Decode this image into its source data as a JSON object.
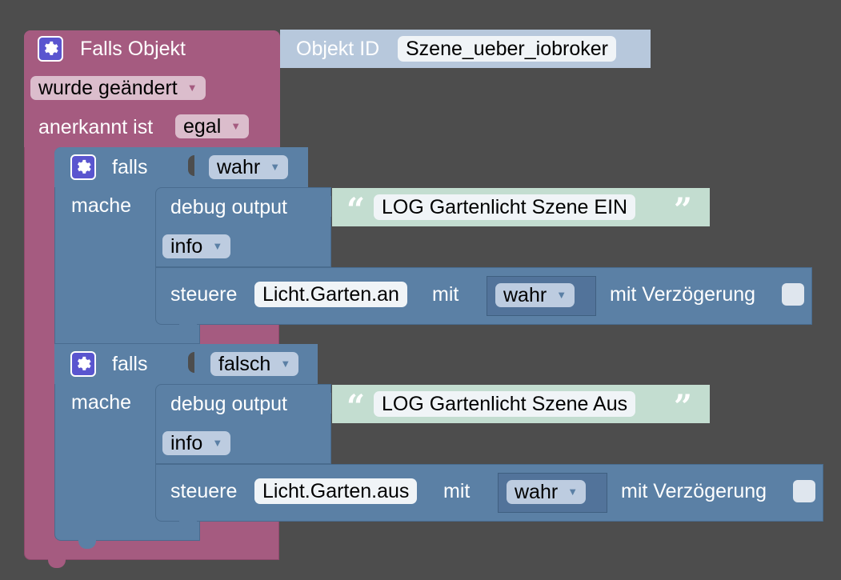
{
  "trigger": {
    "title": "Falls Objekt",
    "objekt_id_label": "Objekt ID",
    "objekt_id_value": "Szene_ueber_iobroker",
    "event": "wurde geändert",
    "ack_label": "anerkannt ist",
    "ack_value": "egal"
  },
  "if_blocks": [
    {
      "falls_label": "falls",
      "condition": "wahr",
      "mache_label": "mache",
      "debug": {
        "label": "debug output",
        "text": "LOG Gartenlicht Szene EIN",
        "level": "info"
      },
      "control": {
        "label": "steuere",
        "object": "Licht.Garten.an",
        "mit_label": "mit",
        "value": "wahr",
        "delay_label": "mit Verzögerung"
      }
    },
    {
      "falls_label": "falls",
      "condition": "falsch",
      "mache_label": "mache",
      "debug": {
        "label": "debug output",
        "text": "LOG Gartenlicht Szene Aus",
        "level": "info"
      },
      "control": {
        "label": "steuere",
        "object": "Licht.Garten.aus",
        "mit_label": "mit",
        "value": "wahr",
        "delay_label": "mit Verzögerung"
      }
    }
  ],
  "colors": {
    "background": "#4d4d4d",
    "trigger_block": "#a55b80",
    "control_block": "#5b80a5",
    "text_block": "#c3ddd0",
    "gear": "#5a55cf"
  },
  "icons": {
    "gear": "gear-icon",
    "open_quote": "“",
    "close_quote": "”",
    "dropdown": "▼"
  }
}
